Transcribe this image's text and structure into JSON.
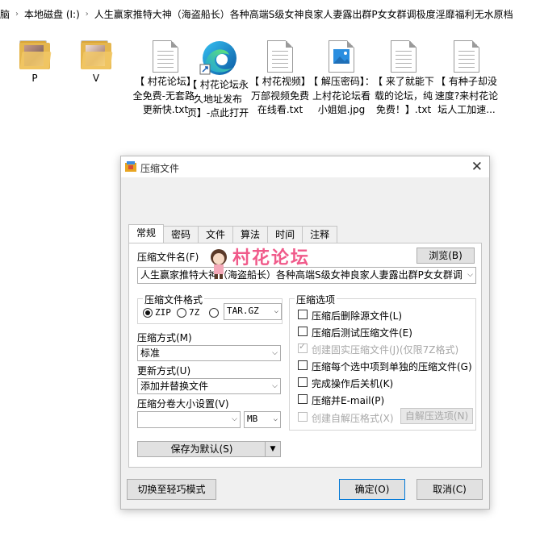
{
  "breadcrumb": {
    "items": [
      "脑",
      "本地磁盘 (I:)",
      "人生赢家推特大神（海盗船长）各种高端S级女神良家人妻露出群P女女群调极度淫靡福利无水原档"
    ]
  },
  "files": [
    {
      "name": "P",
      "icon": "folder-icon"
    },
    {
      "name": "V",
      "icon": "folder-icon"
    },
    {
      "name": "【 村花论坛】全免费-无套路-更新快.txt",
      "icon": "text-file-icon"
    },
    {
      "name": "【 村花论坛永久地址发布页】-点此打开",
      "icon": "edge-shortcut-icon"
    },
    {
      "name": "【 村花视频】万部视频免费在线看.txt",
      "icon": "text-file-icon"
    },
    {
      "name": "【 解压密码】：上村花论坛看小姐姐.jpg",
      "icon": "image-file-icon"
    },
    {
      "name": "【 来了就能下载的论坛，纯免费！】.txt",
      "icon": "text-file-icon"
    },
    {
      "name": "【 有种子却没速度?来村花论坛人工加速...",
      "icon": "text-file-icon"
    }
  ],
  "dialog": {
    "title": "压缩文件",
    "tabs": [
      "常规",
      "密码",
      "文件",
      "算法",
      "时间",
      "注释"
    ],
    "active_tab": "常规",
    "archive_name_label": "压缩文件名(F)",
    "browse_button": "浏览(B)",
    "archive_name_value": "人生赢家推特大神（海盗船长）各种高端S级女神良家人妻露出群P女女群调",
    "watermark": "村花论坛",
    "format_group_label": "压缩文件格式",
    "formats": [
      "ZIP",
      "7Z",
      "TAR.GZ"
    ],
    "selected_format": "ZIP",
    "method_label": "压缩方式(M)",
    "method_value": "标准",
    "update_label": "更新方式(U)",
    "update_value": "添加并替换文件",
    "split_label": "压缩分卷大小设置(V)",
    "split_value": "",
    "split_unit": "MB",
    "save_default_button": "保存为默认(S)",
    "options_group_label": "压缩选项",
    "options": [
      {
        "label": "压缩后删除源文件(L)",
        "checked": false,
        "enabled": true
      },
      {
        "label": "压缩后测试压缩文件(E)",
        "checked": false,
        "enabled": true
      },
      {
        "label": "创建固实压缩文件(J)(仅限7Z格式)",
        "checked": true,
        "enabled": false
      },
      {
        "label": "压缩每个选中项到单独的压缩文件(G)",
        "checked": false,
        "enabled": true
      },
      {
        "label": "完成操作后关机(K)",
        "checked": false,
        "enabled": true
      },
      {
        "label": "压缩并E-mail(P)",
        "checked": false,
        "enabled": true
      },
      {
        "label": "创建自解压格式(X)",
        "checked": false,
        "enabled": false
      }
    ],
    "sfx_options_button": "自解压选项(N)",
    "switch_mode_button": "切换至轻巧模式",
    "ok_button": "确定(O)",
    "cancel_button": "取消(C)"
  }
}
